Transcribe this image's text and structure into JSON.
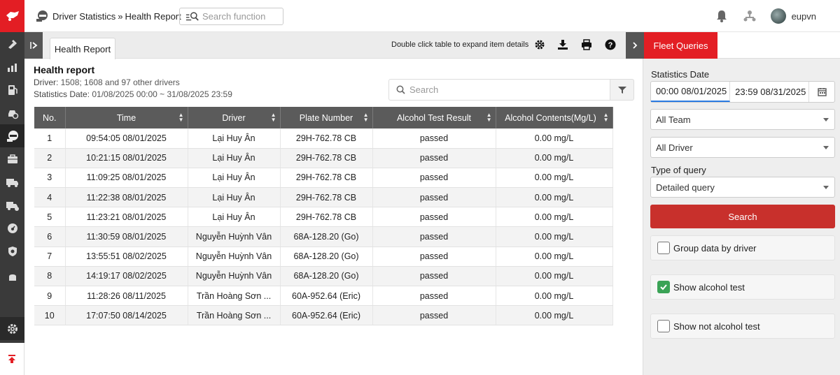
{
  "header": {
    "breadcrumb": [
      "Driver Statistics",
      "Health Report"
    ],
    "breadcrumb_sep": "»",
    "search_placeholder": "Search function",
    "username": "eupvn"
  },
  "sidebar": {
    "items": [
      "map-pin-icon",
      "chart-icon",
      "fuel-icon",
      "car-settings-icon",
      "driver-icon",
      "briefcase-icon",
      "truck-icon",
      "truck-alert-icon",
      "speed-icon",
      "shield-icon",
      "partial-icon"
    ],
    "active_index": 4
  },
  "tabs": {
    "active": "Health Report"
  },
  "toolbar": {
    "hint": "Double click table to expand item details"
  },
  "report": {
    "title": "Health report",
    "driver_label": "Driver",
    "driver_value": ": 1508; 1608 and 97 other drivers",
    "date_label": "Statistics Date",
    "date_value": ": 01/08/2025 00:00 ~ 31/08/2025 23:59",
    "search_placeholder": "Search"
  },
  "table": {
    "columns": [
      "No.",
      "Time",
      "Driver",
      "Plate Number",
      "Alcohol Test Result",
      "Alcohol Contents(Mg/L)"
    ],
    "rows": [
      [
        "1",
        "09:54:05 08/01/2025",
        "Lại Huy Ân",
        "29H-762.78 CB",
        "passed",
        "0.00 mg/L"
      ],
      [
        "2",
        "10:21:15 08/01/2025",
        "Lại Huy Ân",
        "29H-762.78 CB",
        "passed",
        "0.00 mg/L"
      ],
      [
        "3",
        "11:09:25 08/01/2025",
        "Lại Huy Ân",
        "29H-762.78 CB",
        "passed",
        "0.00 mg/L"
      ],
      [
        "4",
        "11:22:38 08/01/2025",
        "Lại Huy Ân",
        "29H-762.78 CB",
        "passed",
        "0.00 mg/L"
      ],
      [
        "5",
        "11:23:21 08/01/2025",
        "Lại Huy Ân",
        "29H-762.78 CB",
        "passed",
        "0.00 mg/L"
      ],
      [
        "6",
        "11:30:59 08/01/2025",
        "Nguyễn Huỳnh Vân",
        "68A-128.20 (Go)",
        "passed",
        "0.00 mg/L"
      ],
      [
        "7",
        "13:55:51 08/02/2025",
        "Nguyễn Huỳnh Vân",
        "68A-128.20 (Go)",
        "passed",
        "0.00 mg/L"
      ],
      [
        "8",
        "14:19:17 08/02/2025",
        "Nguyễn Huỳnh Vân",
        "68A-128.20 (Go)",
        "passed",
        "0.00 mg/L"
      ],
      [
        "9",
        "11:28:26 08/11/2025",
        "Trần Hoàng Sơn ...",
        "60A-952.64 (Eric)",
        "passed",
        "0.00 mg/L"
      ],
      [
        "10",
        "17:07:50 08/14/2025",
        "Trần Hoàng Sơn ...",
        "60A-952.64 (Eric)",
        "passed",
        "0.00 mg/L"
      ]
    ]
  },
  "panel": {
    "tab": "Fleet Queries",
    "stats_date_label": "Statistics Date",
    "date_from": "00:00 08/01/2025",
    "date_to": "23:59 08/31/2025",
    "team": "All Team",
    "driver": "All Driver",
    "query_type_label": "Type of query",
    "query_type": "Detailed query",
    "search_button": "Search",
    "checkboxes": [
      {
        "label": "Group data by driver",
        "checked": false
      },
      {
        "label": "Show alcohol test",
        "checked": true
      },
      {
        "label": "Show not alcohol test",
        "checked": false
      }
    ]
  },
  "colors": {
    "brand_red": "#e31e24",
    "search_red": "#c8302c",
    "header_gray": "#5b5b5b",
    "check_green": "#3aa356"
  }
}
